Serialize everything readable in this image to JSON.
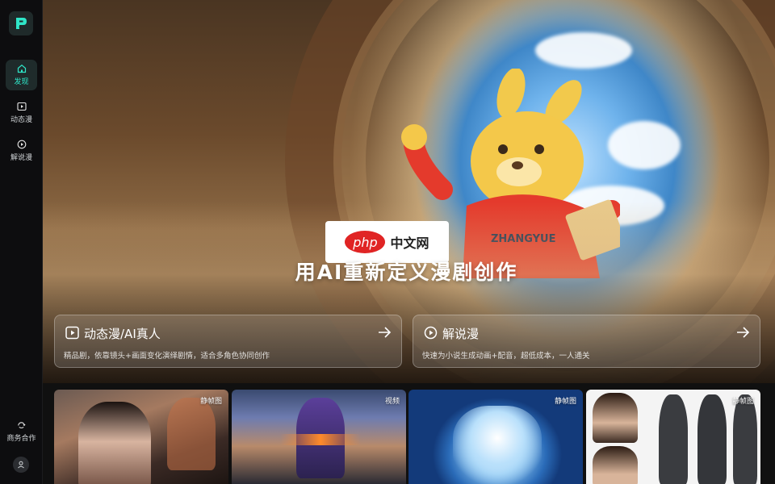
{
  "sidebar": {
    "items": [
      {
        "label": "发现",
        "icon": "home-icon",
        "active": true
      },
      {
        "label": "动态漫",
        "icon": "play-square-icon"
      },
      {
        "label": "解说漫",
        "icon": "play-circle-icon"
      }
    ],
    "business_label": "商务合作",
    "accent_color": "#2fe6c8"
  },
  "hero": {
    "watermark": "中文网",
    "watermark_brand": "php",
    "title": "用AI重新定义漫剧创作",
    "cards": [
      {
        "title": "动态漫/AI真人",
        "desc": "精品剧，依靠镜头+画面变化演绎剧情，适合多角色协同创作"
      },
      {
        "title": "解说漫",
        "desc": "快速为小说生成动画+配音，超低成本，一人通关"
      }
    ]
  },
  "gallery": {
    "items": [
      {
        "tag": "静帧图"
      },
      {
        "tag": "视频"
      },
      {
        "tag": "静帧图"
      },
      {
        "tag": "静帧图"
      }
    ]
  }
}
